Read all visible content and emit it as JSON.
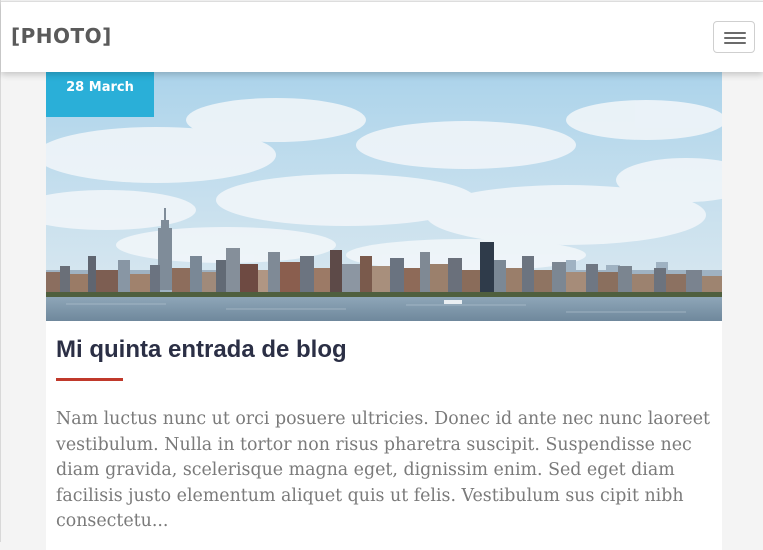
{
  "header": {
    "brand": "[PHOTO]",
    "menu_icon": "hamburger-menu-icon"
  },
  "post": {
    "date": "28 March",
    "image_alt": "New York City skyline across the river",
    "title": "Mi quinta entrada de blog",
    "excerpt": "Nam luctus nunc ut orci posuere ultricies. Donec id ante nec nunc laoreet vestibulum. Nulla in tortor non risus pharetra suscipit. Suspendisse nec diam gravida, scelerisque magna eget, dignissim enim. Sed eget diam facilisis justo elementum aliquet quis ut felis. Vestibulum sus cipit nibh consectetu..."
  },
  "colors": {
    "accent": "#2aafd8",
    "title_rule": "#c0392b",
    "title_text": "#2b2f45",
    "body_text": "#7a7a7a"
  }
}
